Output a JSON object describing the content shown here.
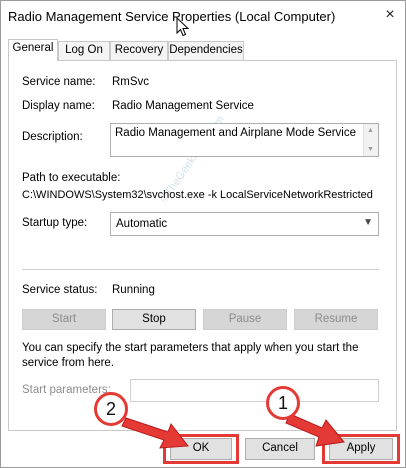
{
  "window": {
    "title": "Radio Management Service Properties (Local Computer)",
    "close_glyph": "×"
  },
  "tabs": [
    {
      "label": "General",
      "active": true
    },
    {
      "label": "Log On"
    },
    {
      "label": "Recovery"
    },
    {
      "label": "Dependencies"
    }
  ],
  "general": {
    "service_name_label": "Service name:",
    "service_name_value": "RmSvc",
    "display_name_label": "Display name:",
    "display_name_value": "Radio Management Service",
    "description_label": "Description:",
    "description_value": "Radio Management and Airplane Mode Service",
    "path_label": "Path to executable:",
    "path_value": "C:\\WINDOWS\\System32\\svchost.exe -k LocalServiceNetworkRestricted",
    "startup_type_label": "Startup type:",
    "startup_type_value": "Automatic",
    "service_status_label": "Service status:",
    "service_status_value": "Running",
    "buttons": {
      "start": "Start",
      "stop": "Stop",
      "pause": "Pause",
      "resume": "Resume"
    },
    "hint_text": "You can specify the start parameters that apply when you start the service from here.",
    "start_params_label": "Start parameters:",
    "start_params_value": ""
  },
  "footer": {
    "ok": "OK",
    "cancel": "Cancel",
    "apply": "Apply"
  },
  "annotations": {
    "badge_1": "1",
    "badge_2": "2",
    "watermark": "©TheGeekPage.com",
    "highlight_color": "#e53935"
  }
}
